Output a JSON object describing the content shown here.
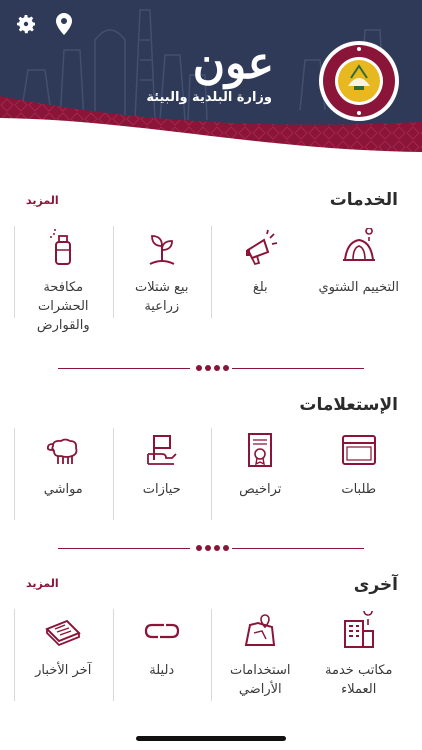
{
  "header": {
    "logo_word": "عون",
    "logo_subtitle": "وزارة البلدية والبيئة",
    "seal_text_top": "دولة قطر",
    "seal_text_bottom": "وزارة البلدية والبيئة",
    "colors": {
      "navy": "#2e3a57",
      "maroon": "#8a1538",
      "gold": "#e7b820"
    }
  },
  "top_icons": {
    "settings_icon": "gear-icon",
    "location_icon": "map-pin-icon"
  },
  "services": {
    "title": "الخدمات",
    "more": "المزيد",
    "items": [
      {
        "label": "التخييم الشتوي",
        "icon": "tent-icon"
      },
      {
        "label": "بلغ",
        "icon": "megaphone-icon"
      },
      {
        "label": "بيع شتلات زراعية",
        "icon": "seedling-icon"
      },
      {
        "label": "مكافحة الحشرات والقوارض",
        "icon": "spray-icon"
      }
    ]
  },
  "inquiries": {
    "title": "الإستعلامات",
    "items": [
      {
        "label": "طلبات",
        "icon": "window-icon"
      },
      {
        "label": "تراخيص",
        "icon": "certificate-icon"
      },
      {
        "label": "حيازات",
        "icon": "holdings-icon"
      },
      {
        "label": "مواشي",
        "icon": "sheep-icon"
      }
    ]
  },
  "other": {
    "title": "آخرى",
    "more": "المزيد",
    "items": [
      {
        "label": "مكاتب خدمة العملاء",
        "icon": "office-building-icon"
      },
      {
        "label": "استخدامات الأراضي",
        "icon": "land-map-icon"
      },
      {
        "label": "دليلة",
        "icon": "chain-link-icon"
      },
      {
        "label": "آخر الأخبار",
        "icon": "newspaper-icon"
      }
    ]
  }
}
